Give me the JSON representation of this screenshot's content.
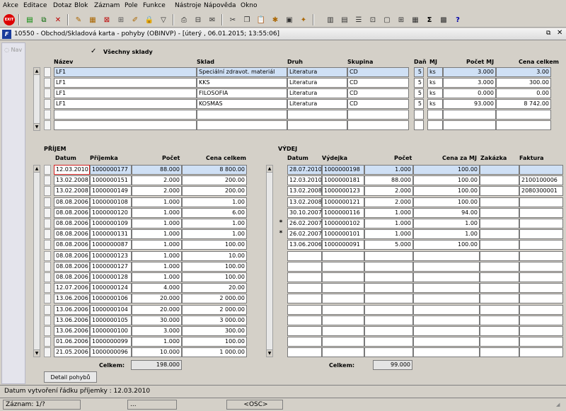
{
  "menu": [
    "Akce",
    "Editace",
    "Dotaz",
    "Blok",
    "Záznam",
    "Pole",
    "Funkce",
    "Nástroje",
    "Nápověda",
    "Okno"
  ],
  "toolbar": {
    "exit_label": "EXIT"
  },
  "window": {
    "title": "10550 - Obchod/Skladová karta - pohyby (OBINVP) - [úterý , 06.01.2015; 13:55:06]"
  },
  "nav": {
    "label": "Nav"
  },
  "top": {
    "all_stores_label": "Všechny sklady",
    "all_stores_checked": true,
    "headers": [
      "Název",
      "Sklad",
      "Druh",
      "Skupina",
      "Daň",
      "MJ",
      "Počet MJ",
      "Cena celkem"
    ],
    "rows": [
      [
        "LF1",
        "Speciální zdravot. materiál",
        "Literatura",
        "CD",
        "5",
        "ks",
        "3.000",
        "3.00"
      ],
      [
        "LF1",
        "KKS",
        "Literatura",
        "CD",
        "5",
        "ks",
        "3.000",
        "300.00"
      ],
      [
        "LF1",
        "FILOSOFIA",
        "Literatura",
        "CD",
        "5",
        "ks",
        "0.000",
        "0.00"
      ],
      [
        "LF1",
        "KOSMAS",
        "Literatura",
        "CD",
        "5",
        "ks",
        "93.000",
        "8 742.00"
      ],
      [
        "",
        "",
        "",
        "",
        "",
        "",
        "",
        ""
      ],
      [
        "",
        "",
        "",
        "",
        "",
        "",
        "",
        ""
      ]
    ]
  },
  "prijem": {
    "title": "PŘÍJEM",
    "headers": [
      "Datum",
      "Příjemka",
      "Počet",
      "Cena celkem"
    ],
    "rows": [
      [
        "12.03.2010",
        "1000000177",
        "88.000",
        "8 800.00"
      ],
      [
        "13.02.2008",
        "1000000151",
        "2.000",
        "200.00"
      ],
      [
        "13.02.2008",
        "1000000149",
        "2.000",
        "200.00"
      ],
      [
        "08.08.2006",
        "1000000108",
        "1.000",
        "1.00"
      ],
      [
        "08.08.2006",
        "1000000120",
        "1.000",
        "6.00"
      ],
      [
        "08.08.2006",
        "1000000109",
        "1.000",
        "1.00"
      ],
      [
        "08.08.2006",
        "1000000131",
        "1.000",
        "1.00"
      ],
      [
        "08.08.2006",
        "1000000087",
        "1.000",
        "100.00"
      ],
      [
        "08.08.2006",
        "1000000123",
        "1.000",
        "10.00"
      ],
      [
        "08.08.2006",
        "1000000127",
        "1.000",
        "100.00"
      ],
      [
        "08.08.2006",
        "1000000128",
        "1.000",
        "100.00"
      ],
      [
        "12.07.2006",
        "1000000124",
        "4.000",
        "20.00"
      ],
      [
        "13.06.2006",
        "1000000106",
        "20.000",
        "2 000.00"
      ],
      [
        "13.06.2006",
        "1000000104",
        "20.000",
        "2 000.00"
      ],
      [
        "13.06.2006",
        "1000000105",
        "30.000",
        "3 000.00"
      ],
      [
        "13.06.2006",
        "1000000100",
        "3.000",
        "300.00"
      ],
      [
        "01.06.2006",
        "1000000099",
        "1.000",
        "100.00"
      ],
      [
        "21.05.2006",
        "1000000096",
        "10.000",
        "1 000.00"
      ]
    ],
    "total_label": "Celkem:",
    "total": "198.000",
    "detail_button": "Detail pohybů"
  },
  "vydej": {
    "title": "VÝDEJ",
    "headers": [
      "Datum",
      "Výdejka",
      "Počet",
      "Cena za MJ",
      "Zakázka",
      "Faktura"
    ],
    "rows": [
      [
        "",
        "28.07.2010",
        "1000000198",
        "1.000",
        "100.00",
        "",
        ""
      ],
      [
        "",
        "12.03.2010",
        "1000000181",
        "88.000",
        "100.00",
        "",
        "2100100006"
      ],
      [
        "",
        "13.02.2008",
        "1000000123",
        "2.000",
        "100.00",
        "",
        "2080300001"
      ],
      [
        "",
        "13.02.2008",
        "1000000121",
        "2.000",
        "100.00",
        "",
        ""
      ],
      [
        "",
        "30.10.2007",
        "1000000116",
        "1.000",
        "94.00",
        "",
        ""
      ],
      [
        "*",
        "26.02.2007",
        "1000000102",
        "1.000",
        "1.00",
        "",
        ""
      ],
      [
        "*",
        "26.02.2007",
        "1000000101",
        "1.000",
        "1.00",
        "",
        ""
      ],
      [
        "",
        "13.06.2006",
        "1000000091",
        "5.000",
        "100.00",
        "",
        ""
      ],
      [
        "",
        "",
        "",
        "",
        "",
        "",
        ""
      ],
      [
        "",
        "",
        "",
        "",
        "",
        "",
        ""
      ],
      [
        "",
        "",
        "",
        "",
        "",
        "",
        ""
      ],
      [
        "",
        "",
        "",
        "",
        "",
        "",
        ""
      ],
      [
        "",
        "",
        "",
        "",
        "",
        "",
        ""
      ],
      [
        "",
        "",
        "",
        "",
        "",
        "",
        ""
      ],
      [
        "",
        "",
        "",
        "",
        "",
        "",
        ""
      ],
      [
        "",
        "",
        "",
        "",
        "",
        "",
        ""
      ],
      [
        "",
        "",
        "",
        "",
        "",
        "",
        ""
      ],
      [
        "",
        "",
        "",
        "",
        "",
        "",
        ""
      ]
    ],
    "total_label": "Celkem:",
    "total": "99.000"
  },
  "status": {
    "message": "Datum vytvoření řádku příjemky : 12.03.2010",
    "record": "Záznam: 1/?",
    "dots": "...",
    "osc": "<OSC>"
  }
}
